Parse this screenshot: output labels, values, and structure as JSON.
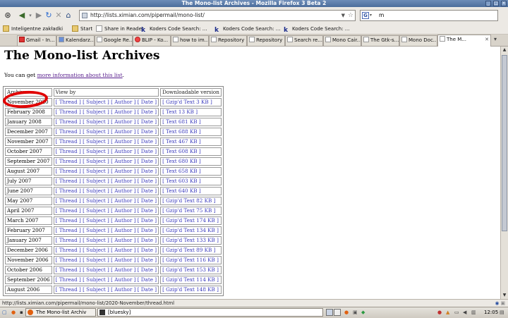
{
  "window": {
    "title": "The Mono-list Archives - Mozilla Firefox 3 Beta 2"
  },
  "nav": {
    "url": "http://lists.ximian.com/pipermail/mono-list/",
    "search_value": "m"
  },
  "bookmarks": [
    "Inteligentne zakładki",
    "Start",
    "Share in Reader",
    "Koders Code Search: ...",
    "Koders Code Search: ...",
    "Koders Code Search: ..."
  ],
  "tabs": [
    "Gmail - In...",
    "Kalendarz...",
    "Google Re...",
    "BLIP - Ko...",
    "how to im...",
    "Repository",
    "Repository",
    "Search re...",
    "Mono Cair...",
    "The Gtk-s...",
    "Mono Doc...",
    "The M..."
  ],
  "page": {
    "heading": "The Mono-list Archives",
    "intro_prefix": "You can get ",
    "intro_link": "more information about this list",
    "intro_suffix": ".",
    "columns": [
      "Archive",
      "View by",
      "Downloadable version"
    ],
    "view_links": [
      "[ Thread ]",
      "[ Subject ]",
      "[ Author ]",
      "[ Date ]"
    ],
    "rows": [
      {
        "period": "November 2020",
        "download": "[ Gzip'd Text 3 KB ]"
      },
      {
        "period": "February 2008",
        "download": "[ Text 13 KB ]"
      },
      {
        "period": "January 2008",
        "download": "[ Text 681 KB ]"
      },
      {
        "period": "December 2007",
        "download": "[ Text 688 KB ]"
      },
      {
        "period": "November 2007",
        "download": "[ Text 467 KB ]"
      },
      {
        "period": "October 2007",
        "download": "[ Text 608 KB ]"
      },
      {
        "period": "September 2007",
        "download": "[ Text 680 KB ]"
      },
      {
        "period": "August 2007",
        "download": "[ Text 658 KB ]"
      },
      {
        "period": "July 2007",
        "download": "[ Text 603 KB ]"
      },
      {
        "period": "June 2007",
        "download": "[ Text 640 KB ]"
      },
      {
        "period": "May 2007",
        "download": "[ Gzip'd Text 82 KB ]"
      },
      {
        "period": "April 2007",
        "download": "[ Gzip'd Text 75 KB ]"
      },
      {
        "period": "March 2007",
        "download": "[ Gzip'd Text 174 KB ]"
      },
      {
        "period": "February 2007",
        "download": "[ Gzip'd Text 134 KB ]"
      },
      {
        "period": "January 2007",
        "download": "[ Gzip'd Text 133 KB ]"
      },
      {
        "period": "December 2006",
        "download": "[ Gzip'd Text 89 KB ]"
      },
      {
        "period": "November 2006",
        "download": "[ Gzip'd Text 116 KB ]"
      },
      {
        "period": "October 2006",
        "download": "[ Gzip'd Text 153 KB ]"
      },
      {
        "period": "September 2006",
        "download": "[ Gzip'd Text 114 KB ]"
      },
      {
        "period": "August 2006",
        "download": "[ Gzip'd Text 148 KB ]"
      }
    ]
  },
  "status": {
    "url": "http://lists.ximian.com/pipermail/mono-list/2020-November/thread.html"
  },
  "taskbar": {
    "firefox_task": "The Mono-list Archiv",
    "terminal_task": "[bluesky]",
    "clock": "12:05"
  }
}
